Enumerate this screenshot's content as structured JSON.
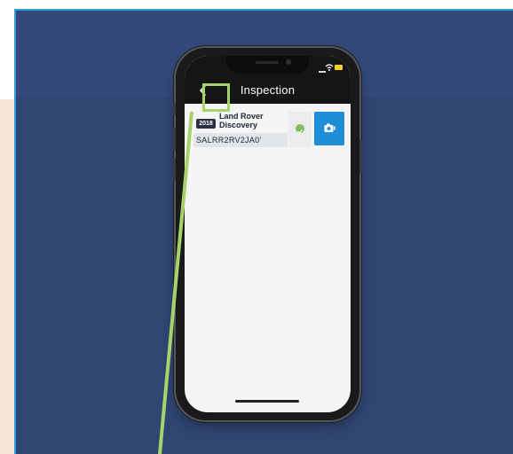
{
  "app": {
    "title": "Inspection"
  },
  "header": {
    "back_icon": "chevron-left-icon"
  },
  "vehicle": {
    "year": "2018",
    "name": "Land Rover Discovery",
    "vin": "SALRR2RV2JA0'",
    "status_icon": "check-circle-icon",
    "status_color": "#7dc05c"
  },
  "actions": {
    "camera_icon": "camera-icon"
  },
  "colors": {
    "slide_background": "#2f4572",
    "accent": "#1e8fd6",
    "highlight": "#a6d36a"
  }
}
